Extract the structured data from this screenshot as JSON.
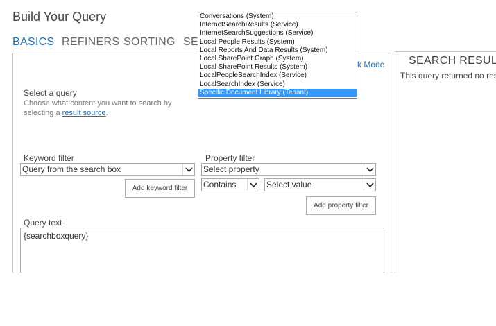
{
  "header": {
    "title": "Build Your Query"
  },
  "tabs": [
    {
      "label": "BASICS",
      "active": true
    },
    {
      "label": "REFINERS"
    },
    {
      "label": "SORTING"
    },
    {
      "label": "SE"
    }
  ],
  "mode_link": "k Mode",
  "select_query": {
    "label": "Select a query",
    "description_line1": "Choose what content you want to search by",
    "description_prefix": "selecting a ",
    "link_text": "result source",
    "description_suffix": "."
  },
  "source_dropdown": {
    "options": [
      "Conversations (System)",
      "InternetSearchResults (Service)",
      "InternetSearchSuggestions (Service)",
      "Local People Results (System)",
      "Local Reports And Data Results (System)",
      "Local SharePoint Graph (System)",
      "Local SharePoint Results (System)",
      "LocalPeopleSearchIndex (Service)",
      "LocalSearchIndex (Service)",
      "Specific Document Library (Tenant)"
    ],
    "selected_index": 9
  },
  "keyword_filter": {
    "label": "Keyword filter",
    "value": "Query from the search box",
    "button": "Add keyword filter"
  },
  "property_filter": {
    "label": "Property filter",
    "property_value": "Select property",
    "operator_value": "Contains",
    "value_value": "Select value",
    "button": "Add property filter"
  },
  "query_text": {
    "label": "Query text",
    "value": "{searchboxquery}"
  },
  "results": {
    "title": "SEARCH RESULT",
    "message": "This query returned no resu"
  },
  "colors": {
    "accent": "#1e6fb5",
    "selection": "#3399ff",
    "border": "#c6c6c6"
  }
}
